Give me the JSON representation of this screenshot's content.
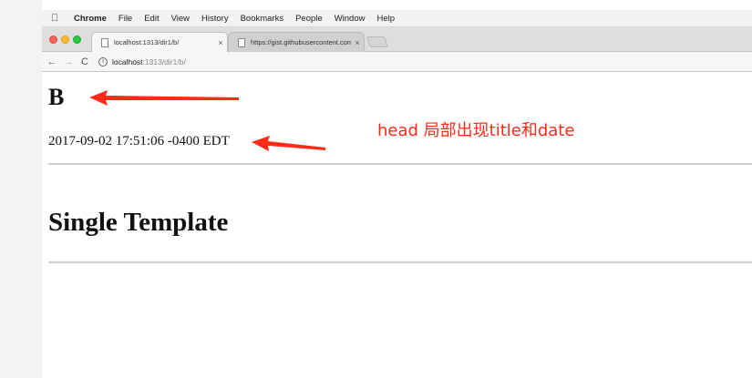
{
  "menubar": {
    "app": "Chrome",
    "items": [
      "File",
      "Edit",
      "View",
      "History",
      "Bookmarks",
      "People",
      "Window",
      "Help"
    ]
  },
  "tabs": [
    {
      "title": "localhost:1313/dir1/b/",
      "close": "×"
    },
    {
      "title": "https://gist.githubusercontent.com",
      "close": "×"
    }
  ],
  "toolbar": {
    "back": "←",
    "forward": "→",
    "reload": "C",
    "url_host": "localhost",
    "url_path": ":1313/dir1/b/"
  },
  "page": {
    "site_title": "B",
    "date": "2017-09-02 17:51:06 -0400 EDT",
    "heading": "Single Template"
  },
  "annotation": {
    "text": "head 局部出现title和date",
    "color": "#ff2a17"
  }
}
